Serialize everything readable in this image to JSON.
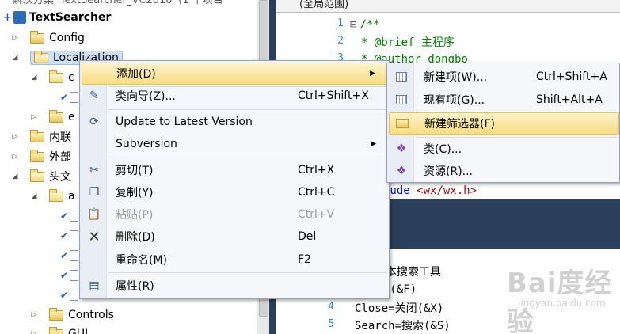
{
  "explorer": {
    "header_partial": "解决方案 'TextSearcher_VC2010' (1 个项目",
    "project": "TextSearcher",
    "items": [
      {
        "label": "Config"
      },
      {
        "label": "Localization"
      },
      {
        "label": "c"
      },
      {
        "label": "e"
      },
      {
        "label": "内联"
      },
      {
        "label": "外部"
      },
      {
        "label": "头文"
      },
      {
        "label": "a"
      },
      {
        "label": "Controls"
      },
      {
        "label": "GUI"
      }
    ]
  },
  "editor": {
    "top_header": "(全局范围)",
    "top_lines": [
      {
        "num": "1",
        "text": "/**"
      },
      {
        "num": "2",
        "text": " * @brief 主程序"
      },
      {
        "num": "3",
        "text": " * @author dongbo"
      }
    ],
    "include_kw": "lude",
    "include_file": "<wx/wx.h>",
    "bottom_lines": [
      {
        "num": "",
        "text": "n]"
      },
      {
        "num": "",
        "text": "e=文本搜索工具"
      },
      {
        "num": "",
        "text": "=文件(&F)"
      },
      {
        "num": "4",
        "text": "Close=关闭(&X)"
      },
      {
        "num": "5",
        "text": "Search=搜索(&S)"
      }
    ]
  },
  "context_menu": {
    "items": [
      {
        "label": "添加(D)",
        "shortcut": ""
      },
      {
        "label": "类向导(Z)...",
        "shortcut": "Ctrl+Shift+X"
      },
      {
        "label": "Update to Latest Version",
        "shortcut": ""
      },
      {
        "label": "Subversion",
        "shortcut": ""
      },
      {
        "label": "剪切(T)",
        "shortcut": "Ctrl+X"
      },
      {
        "label": "复制(Y)",
        "shortcut": "Ctrl+C"
      },
      {
        "label": "粘贴(P)",
        "shortcut": "Ctrl+V"
      },
      {
        "label": "删除(D)",
        "shortcut": "Del"
      },
      {
        "label": "重命名(M)",
        "shortcut": "F2"
      },
      {
        "label": "属性(R)",
        "shortcut": ""
      }
    ]
  },
  "submenu": {
    "items": [
      {
        "label": "新建项(W)...",
        "shortcut": "Ctrl+Shift+A"
      },
      {
        "label": "现有项(G)...",
        "shortcut": "Shift+Alt+A"
      },
      {
        "label": "新建筛选器(F)",
        "shortcut": ""
      },
      {
        "label": "类(C)...",
        "shortcut": ""
      },
      {
        "label": "资源(R)...",
        "shortcut": ""
      }
    ]
  },
  "watermark": {
    "logo": "Bai度经验",
    "site": "jingyan.baidu.com"
  },
  "colors": {
    "menu_highlight": "#f8dd82",
    "editor_frame": "#2b3e5c",
    "comment": "#008000",
    "keyword": "#0000ff"
  }
}
